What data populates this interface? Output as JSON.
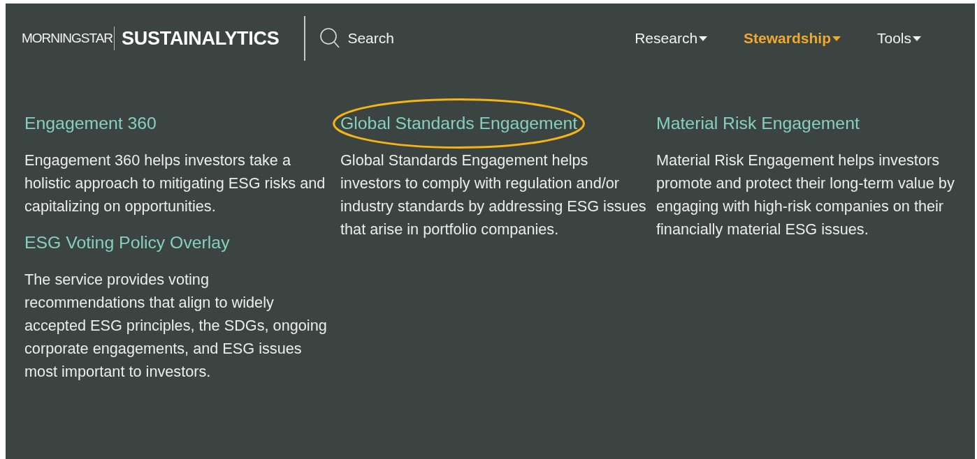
{
  "brand": {
    "parent": "MORNINGSTAR",
    "name": "SUSTAINALYTICS"
  },
  "search": {
    "label": "Search"
  },
  "nav": [
    {
      "label": "Research",
      "selected": false
    },
    {
      "label": "Stewardship",
      "selected": true
    },
    {
      "label": "Tools",
      "selected": false
    }
  ],
  "columns": [
    {
      "sections": [
        {
          "title": "Engagement 360",
          "description": "Engagement 360 helps investors take a holistic approach to mitigating ESG risks and capitalizing on opportunities.",
          "highlighted": false
        },
        {
          "title": "ESG Voting Policy Overlay",
          "description": "The service provides voting recommendations that align to widely accepted ESG principles, the SDGs, ongoing corporate engagements, and ESG issues most important to investors.",
          "highlighted": false
        }
      ]
    },
    {
      "sections": [
        {
          "title": "Global Standards Engagement",
          "description": "Global Standards Engagement helps investors to comply with regulation and/or industry standards by addressing ESG issues that arise in portfolio companies.",
          "highlighted": true
        }
      ]
    },
    {
      "sections": [
        {
          "title": "Material Risk Engagement",
          "description": "Material Risk Engagement helps investors promote and protect their long-term value by engaging with high-risk companies on their financially material ESG issues.",
          "highlighted": false
        }
      ]
    }
  ]
}
